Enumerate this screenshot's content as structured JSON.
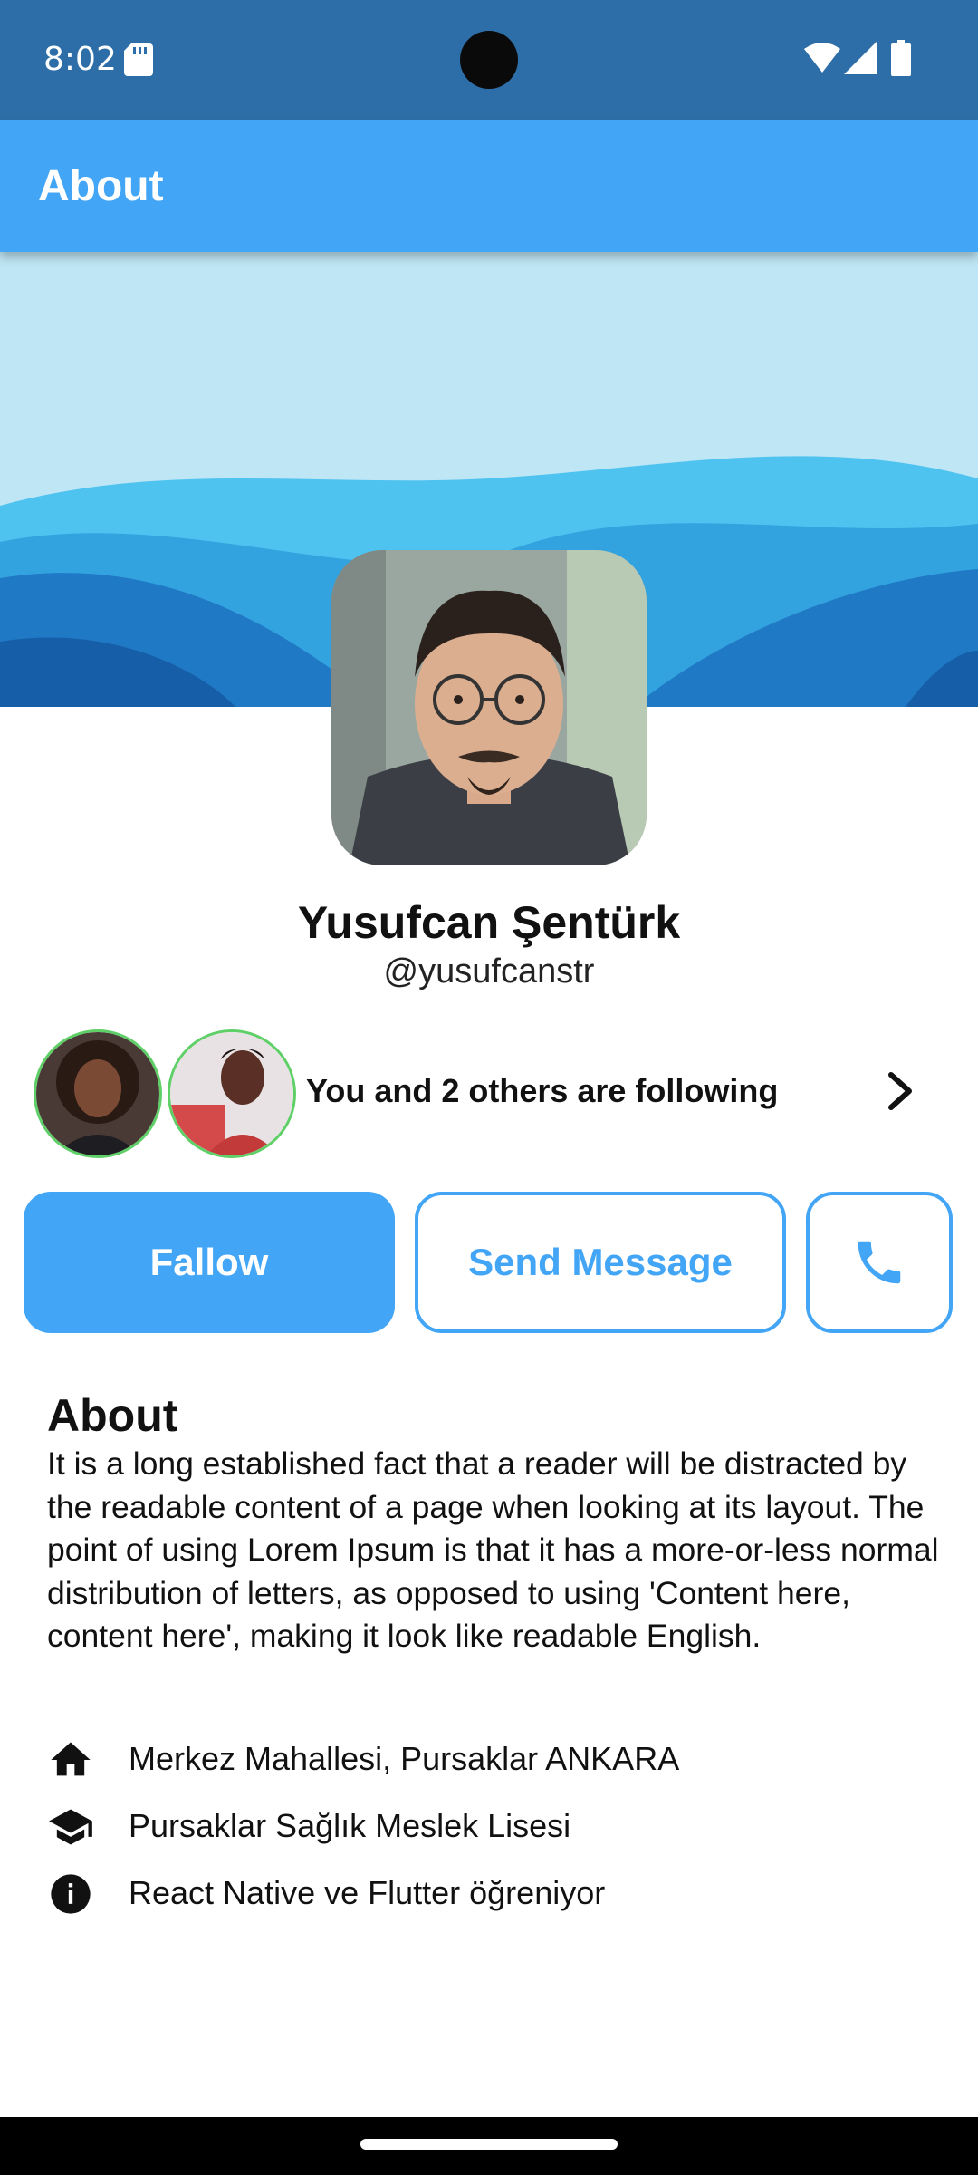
{
  "status_bar": {
    "time": "8:02",
    "icons": [
      "sd-card-icon",
      "wifi-icon",
      "signal-icon",
      "battery-icon"
    ]
  },
  "app_bar": {
    "title": "About",
    "color": "#42a5f5"
  },
  "profile": {
    "name": "Yusufcan Şentürk",
    "handle": "@yusufcanstr"
  },
  "followers": {
    "text": "You and 2 others are following",
    "avatars": [
      "follower-avatar-1",
      "follower-avatar-2"
    ]
  },
  "actions": {
    "follow_label": "Fallow",
    "message_label": "Send Message",
    "call_icon": "phone-icon"
  },
  "about": {
    "heading": "About",
    "body": "It is a long established fact that a reader will be distracted by the readable content of a page when looking at its layout. The point of using Lorem Ipsum is that it has a more-or-less normal distribution of letters, as opposed to using 'Content here, content here', making it look like readable English."
  },
  "info": [
    {
      "icon": "home-icon",
      "text": "Merkez Mahallesi, Pursaklar ANKARA"
    },
    {
      "icon": "school-icon",
      "text": "Pursaklar Sağlık Meslek Lisesi"
    },
    {
      "icon": "info-icon",
      "text": "React Native ve Flutter öğreniyor"
    }
  ],
  "colors": {
    "primary": "#42a5f5",
    "status_bar": "#2e6ea8",
    "follower_ring": "#5fd068"
  }
}
